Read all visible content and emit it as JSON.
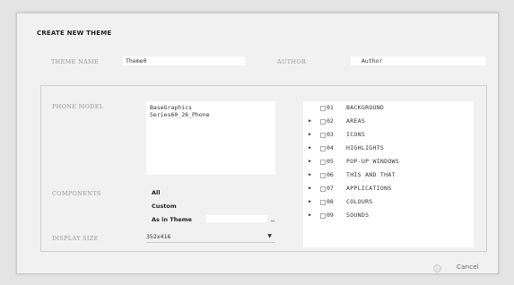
{
  "dialog": {
    "title": "CREATE NEW THEME",
    "theme_name_label": "THEME NAME",
    "theme_name_value": "Theme0",
    "author_label": "AUTHOR",
    "author_value": "Author"
  },
  "phone_models": {
    "label": "PHONE MODEL",
    "items": [
      "BaseGraphics",
      "Series60_26_Phone"
    ]
  },
  "components": {
    "label": "COMPONENTS",
    "options": [
      "All",
      "Custom",
      "As in Theme"
    ],
    "as_in_theme_value": "",
    "browse_label": "_"
  },
  "display_size": {
    "label": "DISPLAY SIZE",
    "value": "352x416"
  },
  "component_list": [
    {
      "num": "01",
      "name": "BACKGROUND",
      "has_children": false
    },
    {
      "num": "02",
      "name": "AREAS",
      "has_children": true
    },
    {
      "num": "03",
      "name": "ICONS",
      "has_children": true
    },
    {
      "num": "04",
      "name": "HIGHLIGHTS",
      "has_children": true
    },
    {
      "num": "05",
      "name": "POP-UP WINDOWS",
      "has_children": true
    },
    {
      "num": "06",
      "name": "THIS AND THAT",
      "has_children": true
    },
    {
      "num": "07",
      "name": "APPLICATIONS",
      "has_children": true
    },
    {
      "num": "08",
      "name": "COLOURS",
      "has_children": true
    },
    {
      "num": "09",
      "name": "SOUNDS",
      "has_children": true
    }
  ],
  "footer": {
    "cancel_label": "Cancel"
  },
  "icons": {
    "expand": "triangle-right-icon",
    "checkbox": "checkbox-icon",
    "dropdown": "chevron-down-icon"
  }
}
